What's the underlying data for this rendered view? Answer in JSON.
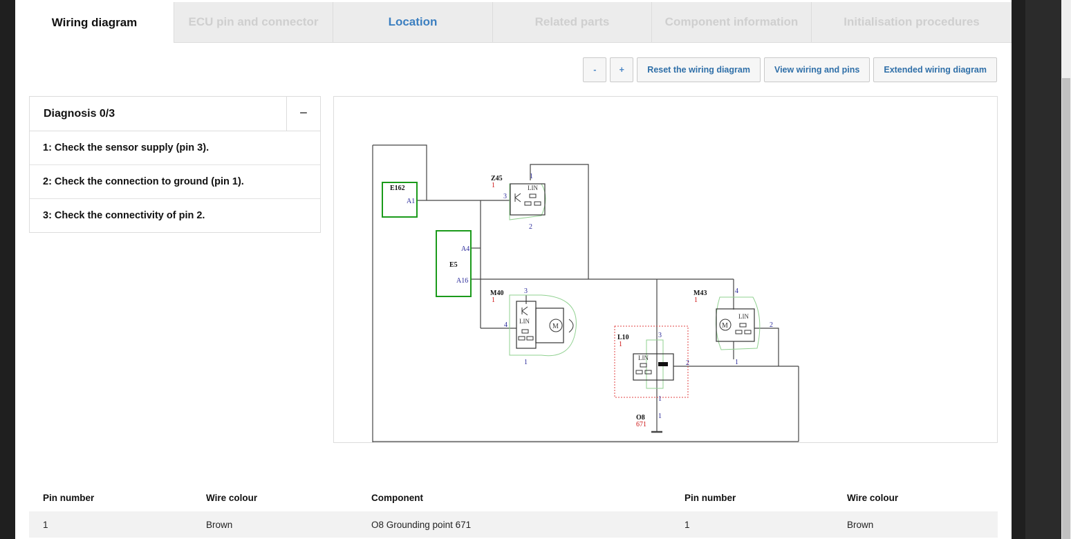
{
  "tabs": [
    {
      "label": "Wiring diagram",
      "state": "active"
    },
    {
      "label": "ECU pin and connector",
      "state": "disabled"
    },
    {
      "label": "Location",
      "state": "link"
    },
    {
      "label": "Related parts",
      "state": "disabled"
    },
    {
      "label": "Component information",
      "state": "disabled"
    },
    {
      "label": "Initialisation procedures",
      "state": "disabled"
    }
  ],
  "toolbar": {
    "zoom_out": "-",
    "zoom_in": "+",
    "reset": "Reset the wiring diagram",
    "view_wiring": "View wiring and pins",
    "extended": "Extended wiring diagram"
  },
  "diagnosis": {
    "title": "Diagnosis 0/3",
    "toggle": "−",
    "steps": [
      "1: Check the sensor supply (pin 3).",
      "2: Check the connection to ground (pin 1).",
      "3: Check the connectivity of pin 2."
    ]
  },
  "schematic": {
    "components": {
      "e162": {
        "name": "E162",
        "pin_a1": "A1"
      },
      "e5": {
        "name": "E5",
        "pin_a4": "A4",
        "pin_a16": "A16"
      },
      "z45": {
        "name": "Z45",
        "index": "1",
        "pin1": "1",
        "pin2": "2",
        "pin3": "3",
        "lin": "LIN"
      },
      "m40": {
        "name": "M40",
        "index": "1",
        "pin1": "1",
        "pin3": "3",
        "pin4": "4",
        "lin": "LIN",
        "motor": "M"
      },
      "m43": {
        "name": "M43",
        "index": "1",
        "pin1": "1",
        "pin2": "2",
        "pin4": "4",
        "lin": "LIN",
        "motor": "M"
      },
      "l10": {
        "name": "L10",
        "index": "1",
        "pin1": "1",
        "pin2": "2",
        "pin3": "3",
        "lin": "LIN"
      },
      "o8": {
        "name": "O8",
        "index": "671",
        "pin1": "1"
      }
    },
    "colors": {
      "wire": "#444444",
      "ecu": "#1a9a1a",
      "halo": "#8fd08f",
      "pin": "#2a2a9a",
      "index": "#cc1111",
      "highlight": "#e04040"
    }
  },
  "pin_table": {
    "headers": [
      "Pin number",
      "Wire colour",
      "Component",
      "Pin number",
      "Wire colour"
    ],
    "rows": [
      [
        "1",
        "Brown",
        "O8 Grounding point 671",
        "1",
        "Brown"
      ]
    ]
  },
  "colors": {
    "accent": "#3c7fc0",
    "tab_inactive_bg": "#ececec",
    "row_bg": "#f2f2f2"
  }
}
